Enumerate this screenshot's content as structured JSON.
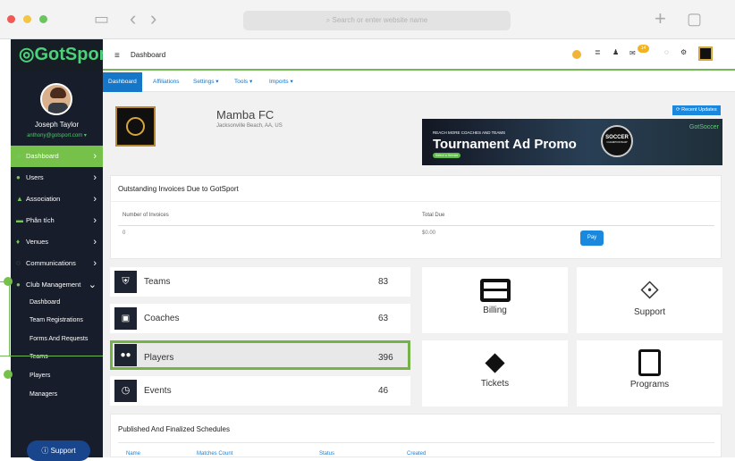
{
  "browser": {
    "search_placeholder": "Search or enter website name"
  },
  "app": {
    "brand": "GotSport",
    "page_title": "Dashboard"
  },
  "user": {
    "name": "Joseph Taylor",
    "email": "anthony@gotsport.com ▾",
    "badge": "14"
  },
  "sidebar": {
    "items": [
      {
        "label": "Dashboard",
        "icon": "dashboard-icon"
      },
      {
        "label": "Users",
        "icon": "users-icon"
      },
      {
        "label": "Association",
        "icon": "association-icon"
      },
      {
        "label": "Phân tích",
        "icon": "analytics-icon"
      },
      {
        "label": "Venues",
        "icon": "venues-icon"
      },
      {
        "label": "Communications",
        "icon": "communications-icon"
      },
      {
        "label": "Club Management",
        "icon": "club-icon"
      }
    ],
    "subitems": [
      "Dashboard",
      "Team Registrations",
      "Forms And Requests",
      "Teams",
      "Players",
      "Managers"
    ],
    "support_label": "Support"
  },
  "tabs": [
    "Dashboard",
    "Affiliations",
    "Settings ▾",
    "Tools ▾",
    "Imports ▾"
  ],
  "recent_updates": "⟳ Recent Updates",
  "club": {
    "name": "Mamba FC",
    "location": "Jacksonville Beach, AA, US"
  },
  "ad": {
    "small": "REACH MORE COACHES AND TEAMS",
    "title": "Tournament Ad Promo",
    "button": "Select a Service",
    "brand": "GotSoccer",
    "badge_top": "SOCCER",
    "badge_bottom": "CHAMPIONSHIP"
  },
  "invoices": {
    "title": "Outstanding Invoices Due to GotSport",
    "col1": "Number of Invoices",
    "col2": "Total Due",
    "count": "0",
    "total": "$0.00",
    "pay": "Pay"
  },
  "stats": [
    {
      "label": "Teams",
      "count": "83"
    },
    {
      "label": "Coaches",
      "count": "63"
    },
    {
      "label": "Players",
      "count": "396"
    },
    {
      "label": "Events",
      "count": "46"
    }
  ],
  "tiles": [
    "Billing",
    "Support",
    "Tickets",
    "Programs"
  ],
  "schedules": {
    "title": "Published And Finalized Schedules",
    "columns": [
      "Name",
      "Matches Count",
      "Status",
      "Created"
    ]
  }
}
